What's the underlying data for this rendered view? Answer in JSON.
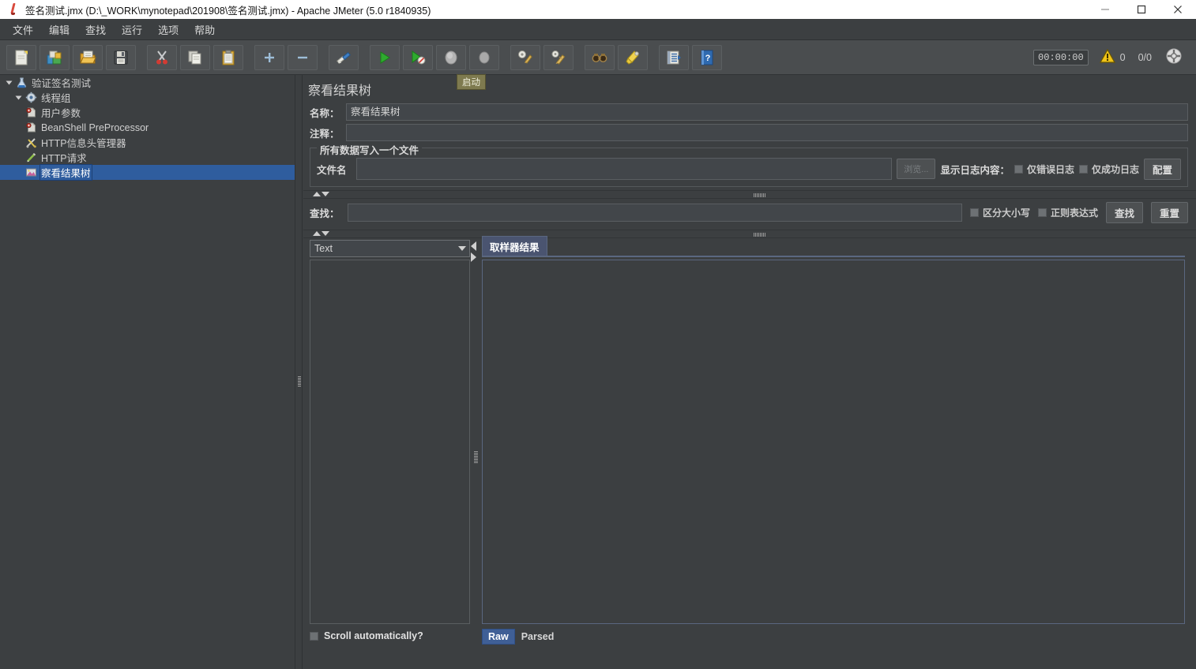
{
  "window": {
    "title": "签名测试.jmx (D:\\_WORK\\mynotepad\\201908\\签名测试.jmx) - Apache JMeter (5.0 r1840935)",
    "app_icon": "jmeter-feather-icon",
    "minimize_label": "–",
    "maximize_label": "□",
    "close_label": "✕"
  },
  "menubar": {
    "items": [
      {
        "label": "文件",
        "name": "menu-file"
      },
      {
        "label": "编辑",
        "name": "menu-edit"
      },
      {
        "label": "查找",
        "name": "menu-search"
      },
      {
        "label": "运行",
        "name": "menu-run"
      },
      {
        "label": "选项",
        "name": "menu-options"
      },
      {
        "label": "帮助",
        "name": "menu-help"
      }
    ]
  },
  "toolbar": {
    "buttons": [
      {
        "name": "new-button",
        "icon": "new-document-icon"
      },
      {
        "name": "templates-button",
        "icon": "templates-icon"
      },
      {
        "name": "open-button",
        "icon": "open-folder-icon"
      },
      {
        "name": "save-button",
        "icon": "save-floppy-icon"
      },
      {
        "name": "cut-button",
        "icon": "scissors-icon"
      },
      {
        "name": "copy-button",
        "icon": "copy-icon"
      },
      {
        "name": "paste-button",
        "icon": "clipboard-paste-icon"
      },
      {
        "name": "expand-all-button",
        "icon": "plus-icon"
      },
      {
        "name": "collapse-all-button",
        "icon": "minus-icon"
      },
      {
        "name": "toggle-button",
        "icon": "wand-toggle-icon"
      },
      {
        "name": "start-button",
        "icon": "play-green-icon"
      },
      {
        "name": "start-no-pause-button",
        "icon": "play-no-timer-icon"
      },
      {
        "name": "stop-button",
        "icon": "stop-circle-icon"
      },
      {
        "name": "shutdown-button",
        "icon": "shutdown-circle-icon"
      },
      {
        "name": "clear-button",
        "icon": "clear-gear-icon"
      },
      {
        "name": "clear-all-button",
        "icon": "clear-all-gear-icon"
      },
      {
        "name": "search-tree-button",
        "icon": "binoculars-icon"
      },
      {
        "name": "reset-search-button",
        "icon": "clear-bell-icon"
      },
      {
        "name": "function-helper-button",
        "icon": "log-list-icon"
      },
      {
        "name": "help-button",
        "icon": "help-book-icon"
      }
    ],
    "timer": "00:00:00",
    "warning_count": "0",
    "thread_count": "0/0",
    "globe_icon": "remote-globe-icon",
    "warning_icon": "warning-triangle-icon",
    "tooltip": "启动"
  },
  "tree": {
    "nodes": [
      {
        "label": "验证签名测试",
        "icon": "test-plan-icon",
        "indent": 0,
        "expanded": true,
        "selected": false
      },
      {
        "label": "线程组",
        "icon": "thread-group-icon",
        "indent": 1,
        "expanded": true,
        "selected": false
      },
      {
        "label": "用户参数",
        "icon": "preprocessor-icon",
        "indent": 2,
        "expanded": false,
        "selected": false
      },
      {
        "label": "BeanShell PreProcessor",
        "icon": "preprocessor-icon",
        "indent": 2,
        "expanded": false,
        "selected": false
      },
      {
        "label": "HTTP信息头管理器",
        "icon": "header-manager-icon",
        "indent": 2,
        "expanded": false,
        "selected": false
      },
      {
        "label": "HTTP请求",
        "icon": "http-request-icon",
        "indent": 2,
        "expanded": false,
        "selected": false
      },
      {
        "label": "察看结果树",
        "icon": "view-results-tree-icon",
        "indent": 2,
        "expanded": false,
        "selected": true
      }
    ]
  },
  "panel": {
    "title": "察看结果树",
    "name_label": "名称：",
    "name_value": "察看结果树",
    "comment_label": "注释：",
    "comment_value": "",
    "file_group_title": "所有数据写入一个文件",
    "filename_label": "文件名",
    "filename_value": "",
    "browse_label": "浏览...",
    "log_display_label": "显示日志内容：",
    "errors_only_label": "仅错误日志",
    "success_only_label": "仅成功日志",
    "configure_label": "配置",
    "search_label": "查找：",
    "search_value": "",
    "case_sensitive_label": "区分大小写",
    "regex_label": "正则表达式",
    "search_button_label": "查找",
    "reset_button_label": "重置",
    "renderer_value": "Text",
    "scroll_auto_label": "Scroll automatically?",
    "result_tabs": [
      {
        "label": "取样器结果",
        "active": true
      }
    ],
    "raw_parsed_tabs": [
      {
        "label": "Raw",
        "active": true
      },
      {
        "label": "Parsed",
        "active": false
      }
    ]
  },
  "colors": {
    "window_bg": "#3c3f41",
    "toolbar_bg": "#4a4d4f",
    "selection_blue": "#2f5d9e",
    "tab_blue": "#4a5470",
    "accent_border": "#5a6780"
  }
}
